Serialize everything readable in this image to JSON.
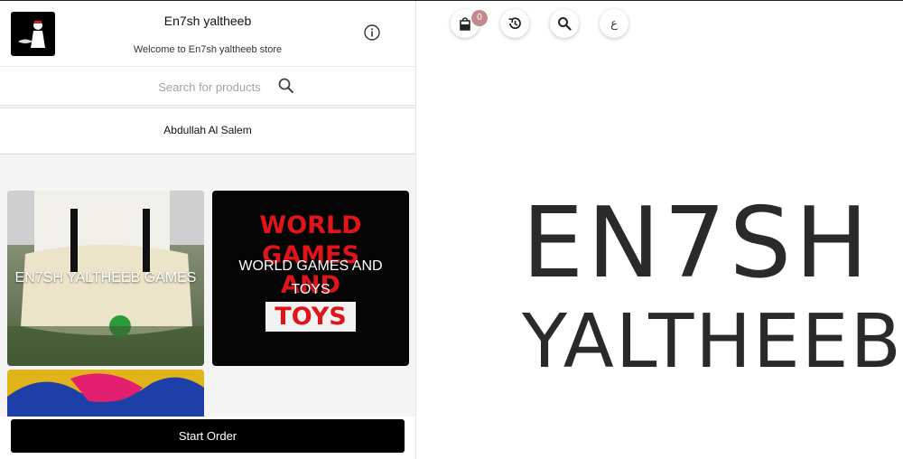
{
  "store": {
    "name": "En7sh yaltheeb",
    "welcome": "Welcome to En7sh yaltheeb store"
  },
  "search": {
    "placeholder": "Search for products"
  },
  "branch": {
    "name": "Abdullah Al Salem"
  },
  "categories": [
    {
      "label": "EN7SH YALTHEEB GAMES"
    },
    {
      "label": "WORLD GAMES AND TOYS",
      "artwork_text": [
        "WORLD",
        "GAMES",
        "AND",
        "TOYS"
      ]
    },
    {
      "label": ""
    }
  ],
  "actions": {
    "start_order": "Start Order"
  },
  "toolbar": {
    "cart_count": "0",
    "language": "ع"
  },
  "brand": {
    "line1": "EN7SH",
    "line2": "YALTHEEB"
  },
  "colors": {
    "badge": "#c28a8f",
    "button": "#000000",
    "artwork_red": "#e0141b"
  }
}
